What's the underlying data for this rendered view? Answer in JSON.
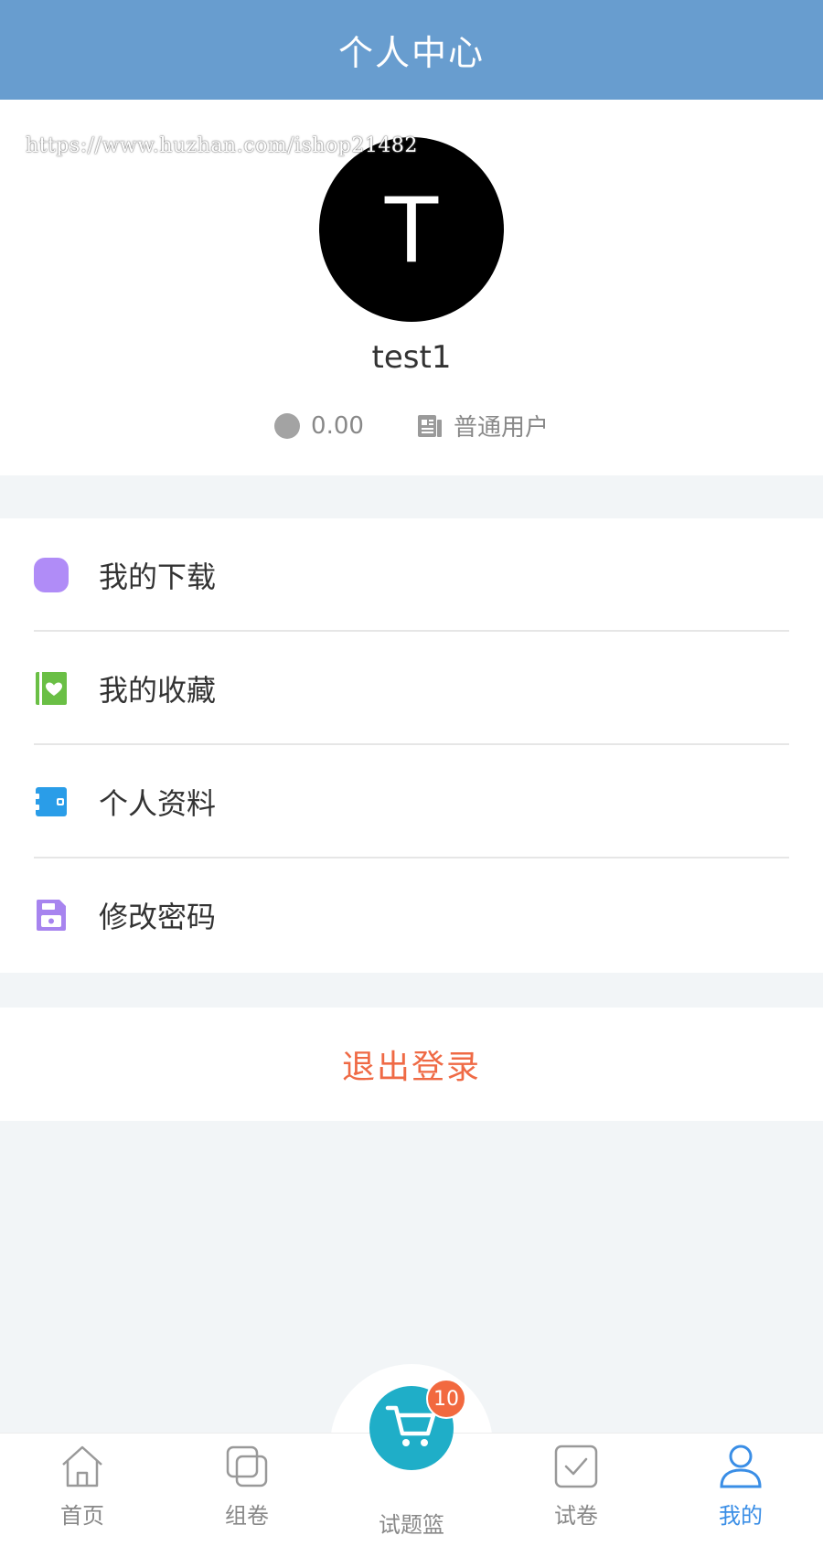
{
  "header": {
    "title": "个人中心"
  },
  "watermark": "https://www.huzhan.com/ishop21482",
  "profile": {
    "avatar_letter": "T",
    "username": "test1",
    "balance": "0.00",
    "role": "普通用户"
  },
  "menu": {
    "items": [
      {
        "label": "我的下载",
        "icon": "download-icon",
        "color": "#b08cf7"
      },
      {
        "label": "我的收藏",
        "icon": "favorite-book-icon",
        "color": "#6abf45"
      },
      {
        "label": "个人资料",
        "icon": "profile-card-icon",
        "color": "#2a9de8"
      },
      {
        "label": "修改密码",
        "icon": "save-lock-icon",
        "color": "#a784ef"
      }
    ]
  },
  "logout": {
    "label": "退出登录",
    "color": "#ef6a45"
  },
  "tabbar": {
    "tabs": [
      {
        "label": "首页",
        "icon": "home-icon"
      },
      {
        "label": "组卷",
        "icon": "compose-icon"
      },
      {
        "label": "试题篮",
        "icon": "cart-icon",
        "badge": "10"
      },
      {
        "label": "试卷",
        "icon": "checkbox-icon"
      },
      {
        "label": "我的",
        "icon": "user-icon",
        "active": true
      }
    ]
  },
  "colors": {
    "header": "#689dcf",
    "active_tab": "#3a8ee6",
    "cart": "#1faec8",
    "badge": "#f2693f"
  }
}
